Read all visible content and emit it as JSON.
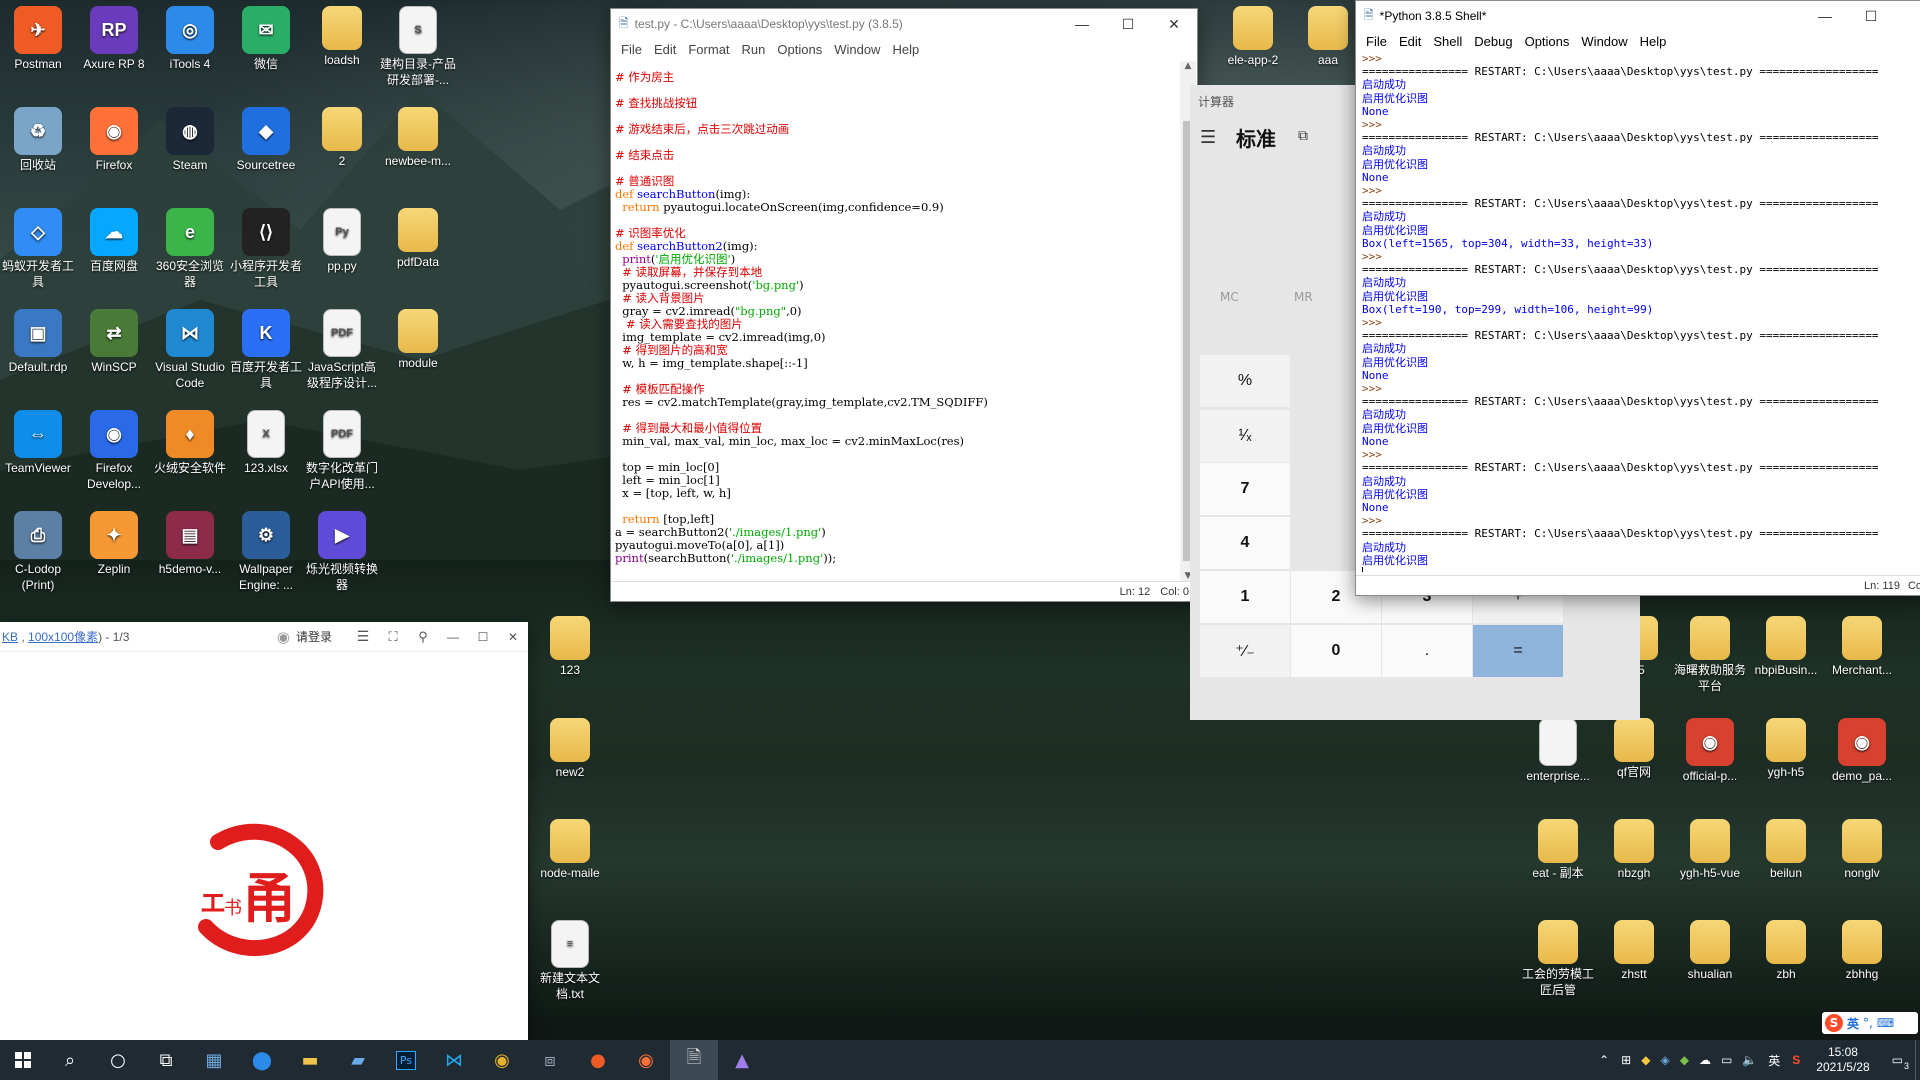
{
  "desktop": {
    "icons": [
      {
        "label": "Postman",
        "glyph": "✈",
        "color": "#ef5b25"
      },
      {
        "label": "Axure RP 8",
        "glyph": "RP",
        "color": "#6a3bbd"
      },
      {
        "label": "iTools 4",
        "glyph": "◎",
        "color": "#2c8ae8"
      },
      {
        "label": "微信",
        "glyph": "✉",
        "color": "#2aae67"
      },
      {
        "label": "loadsh",
        "glyph": "",
        "color": "folder"
      },
      {
        "label": "建构目录-产品研发部署-...",
        "glyph": "S",
        "color": "doc"
      },
      {
        "label": "回收站",
        "glyph": "♻",
        "color": "#7aa5c8"
      },
      {
        "label": "Firefox",
        "glyph": "◉",
        "color": "#ff7139"
      },
      {
        "label": "Steam",
        "glyph": "◍",
        "color": "#1b2838"
      },
      {
        "label": "Sourcetree",
        "glyph": "◆",
        "color": "#1f6fe0"
      },
      {
        "label": "2",
        "glyph": "",
        "color": "folder"
      },
      {
        "label": "newbee-m...",
        "glyph": "",
        "color": "folder"
      },
      {
        "label": "蚂蚁开发者工具",
        "glyph": "◇",
        "color": "#2f8df3"
      },
      {
        "label": "百度网盘",
        "glyph": "☁",
        "color": "#06a7ff"
      },
      {
        "label": "360安全浏览器",
        "glyph": "e",
        "color": "#3bb54a"
      },
      {
        "label": "小程序开发者工具",
        "glyph": "⟨⟩",
        "color": "#222"
      },
      {
        "label": "pp.py",
        "glyph": "Py",
        "color": "doc"
      },
      {
        "label": "pdfData",
        "glyph": "",
        "color": "folder"
      },
      {
        "label": "Default.rdp",
        "glyph": "▣",
        "color": "#3a78c3"
      },
      {
        "label": "WinSCP",
        "glyph": "⇄",
        "color": "#4a7a38"
      },
      {
        "label": "Visual Studio Code",
        "glyph": "⋈",
        "color": "#1f8ad2"
      },
      {
        "label": "百度开发者工具",
        "glyph": "K",
        "color": "#2a6ff5"
      },
      {
        "label": "JavaScript高级程序设计...",
        "glyph": "PDF",
        "color": "doc"
      },
      {
        "label": "module",
        "glyph": "",
        "color": "folder"
      },
      {
        "label": "TeamViewer",
        "glyph": "⇔",
        "color": "#0e8ee9"
      },
      {
        "label": "Firefox Develop...",
        "glyph": "◉",
        "color": "#2a6ae8"
      },
      {
        "label": "火绒安全软件",
        "glyph": "♦",
        "color": "#f08a24"
      },
      {
        "label": "123.xlsx",
        "glyph": "X",
        "color": "doc"
      },
      {
        "label": "数字化改革门户API使用...",
        "glyph": "PDF",
        "color": "doc"
      },
      {
        "label": "C-Lodop (Print)",
        "glyph": "⎙",
        "color": "#5c7fa6"
      },
      {
        "label": "Zeplin",
        "glyph": "✦",
        "color": "#f69833"
      },
      {
        "label": "h5demo-v...",
        "glyph": "▤",
        "color": "#8c2b4a"
      },
      {
        "label": "Wallpaper Engine: ...",
        "glyph": "⚙",
        "color": "#2a5d9a"
      },
      {
        "label": "烁光视频转换器",
        "glyph": "▶",
        "color": "#5f4bd8"
      },
      {
        "label": "ele-app-2",
        "glyph": "",
        "color": "folder"
      },
      {
        "label": "aaa",
        "glyph": "",
        "color": "folder"
      },
      {
        "label": "123",
        "glyph": "",
        "color": "folder"
      },
      {
        "label": "new2",
        "glyph": "",
        "color": "folder"
      },
      {
        "label": "node-maile",
        "glyph": "",
        "color": "folder"
      },
      {
        "label": "新建文本文档.txt",
        "glyph": "≡",
        "color": "doc"
      },
      {
        "label": "h5",
        "glyph": "",
        "color": "folder"
      },
      {
        "label": "海曙救助服务平台",
        "glyph": "",
        "color": "folder"
      },
      {
        "label": "nbpiBusin...",
        "glyph": "",
        "color": "folder"
      },
      {
        "label": "Merchant...",
        "glyph": "",
        "color": "folder"
      },
      {
        "label": "enterprise...",
        "glyph": "",
        "color": "doc"
      },
      {
        "label": "qf官网",
        "glyph": "",
        "color": "folder"
      },
      {
        "label": "official-p...",
        "glyph": "◉",
        "color": "#d8412f"
      },
      {
        "label": "ygh-h5",
        "glyph": "",
        "color": "folder"
      },
      {
        "label": "demo_pa...",
        "glyph": "◉",
        "color": "#d8412f"
      },
      {
        "label": "eat - 副本",
        "glyph": "",
        "color": "folder"
      },
      {
        "label": "nbzgh",
        "glyph": "",
        "color": "folder"
      },
      {
        "label": "ygh-h5-vue",
        "glyph": "",
        "color": "folder"
      },
      {
        "label": "beilun",
        "glyph": "",
        "color": "folder"
      },
      {
        "label": "nonglv",
        "glyph": "",
        "color": "folder"
      },
      {
        "label": "工会的劳模工匠后管",
        "glyph": "",
        "color": "folder"
      },
      {
        "label": "zhstt",
        "glyph": "",
        "color": "folder"
      },
      {
        "label": "shualian",
        "glyph": "",
        "color": "folder"
      },
      {
        "label": "zbh",
        "glyph": "",
        "color": "folder"
      },
      {
        "label": "zbhhg",
        "glyph": "",
        "color": "folder"
      }
    ]
  },
  "editor": {
    "title": "test.py - C:\\Users\\aaaa\\Desktop\\yys\\test.py (3.8.5)",
    "menu": [
      "File",
      "Edit",
      "Format",
      "Run",
      "Options",
      "Window",
      "Help"
    ],
    "status_ln": "Ln: 12",
    "status_col": "Col: 0",
    "lines": [
      [
        [
          "cm",
          "# 作为房主"
        ]
      ],
      [
        [
          "",
          ""
        ]
      ],
      [
        [
          "cm",
          "# 查找挑战按钮"
        ]
      ],
      [
        [
          "",
          ""
        ]
      ],
      [
        [
          "cm",
          "# 游戏结束后，点击三次跳过动画"
        ]
      ],
      [
        [
          "",
          ""
        ]
      ],
      [
        [
          "cm",
          "# 结束点击"
        ]
      ],
      [
        [
          "",
          ""
        ]
      ],
      [
        [
          "cm",
          "# 普通识图"
        ]
      ],
      [
        [
          "kw",
          "def "
        ],
        [
          "df",
          "searchButton"
        ],
        [
          "",
          "(img):"
        ]
      ],
      [
        [
          "kw",
          "  return "
        ],
        [
          "",
          "pyautogui.locateOnScreen(img,confidence=0.9)"
        ]
      ],
      [
        [
          "",
          ""
        ]
      ],
      [
        [
          "cm",
          "# 识图率优化"
        ]
      ],
      [
        [
          "kw",
          "def "
        ],
        [
          "df",
          "searchButton2"
        ],
        [
          "",
          "(img):"
        ]
      ],
      [
        [
          "bi",
          "  print"
        ],
        [
          "",
          "("
        ],
        [
          "st",
          "'启用优化识图'"
        ],
        [
          "",
          ")"
        ]
      ],
      [
        [
          "cm",
          "  # 读取屏幕，并保存到本地"
        ]
      ],
      [
        [
          "",
          "  pyautogui.screenshot("
        ],
        [
          "st",
          "'bg.png'"
        ],
        [
          "",
          ")"
        ]
      ],
      [
        [
          "cm",
          "  # 读入背景图片"
        ]
      ],
      [
        [
          "",
          "  gray = cv2.imread("
        ],
        [
          "st",
          "\"bg.png\""
        ],
        [
          "",
          ",0)"
        ]
      ],
      [
        [
          "cm",
          "   # 读入需要查找的图片"
        ]
      ],
      [
        [
          "",
          "  img_template = cv2.imread(img,0)"
        ]
      ],
      [
        [
          "cm",
          "  # 得到图片的高和宽"
        ]
      ],
      [
        [
          "",
          "  w, h = img_template.shape[::-1]"
        ]
      ],
      [
        [
          "",
          ""
        ]
      ],
      [
        [
          "cm",
          "  # 模板匹配操作"
        ]
      ],
      [
        [
          "",
          "  res = cv2.matchTemplate(gray,img_template,cv2.TM_SQDIFF)"
        ]
      ],
      [
        [
          "",
          ""
        ]
      ],
      [
        [
          "cm",
          "  # 得到最大和最小值得位置"
        ]
      ],
      [
        [
          "",
          "  min_val, max_val, min_loc, max_loc = cv2.minMaxLoc(res)"
        ]
      ],
      [
        [
          "",
          ""
        ]
      ],
      [
        [
          "",
          "  top = min_loc[0]"
        ]
      ],
      [
        [
          "",
          "  left = min_loc[1]"
        ]
      ],
      [
        [
          "",
          "  x = [top, left, w, h]"
        ]
      ],
      [
        [
          "",
          ""
        ]
      ],
      [
        [
          "kw",
          "  return "
        ],
        [
          "",
          "[top,left]"
        ]
      ],
      [
        [
          "",
          "a = searchButton2("
        ],
        [
          "st",
          "'./images/1.png'"
        ],
        [
          "",
          ")"
        ]
      ],
      [
        [
          "",
          "pyautogui.moveTo(a[0], a[1])"
        ]
      ],
      [
        [
          "bi",
          "print"
        ],
        [
          "",
          "(searchButton("
        ],
        [
          "st",
          "'./images/1.png'"
        ],
        [
          "",
          "));"
        ]
      ]
    ]
  },
  "shell": {
    "title": "*Python 3.8.5 Shell*",
    "menu": [
      "File",
      "Edit",
      "Shell",
      "Debug",
      "Options",
      "Window",
      "Help"
    ],
    "status_ln": "Ln: 119",
    "status_col": "Co",
    "lines": [
      [
        [
          "prompt",
          ">>> "
        ]
      ],
      [
        [
          "",
          "================ RESTART: C:\\Users\\aaaa\\Desktop\\yys\\test.py =================="
        ]
      ],
      [
        [
          "out",
          "启动成功"
        ]
      ],
      [
        [
          "out",
          "启用优化识图"
        ]
      ],
      [
        [
          "out",
          "None"
        ]
      ],
      [
        [
          "prompt",
          ">>> "
        ]
      ],
      [
        [
          "",
          "================ RESTART: C:\\Users\\aaaa\\Desktop\\yys\\test.py =================="
        ]
      ],
      [
        [
          "out",
          "启动成功"
        ]
      ],
      [
        [
          "out",
          "启用优化识图"
        ]
      ],
      [
        [
          "out",
          "None"
        ]
      ],
      [
        [
          "prompt",
          ">>> "
        ]
      ],
      [
        [
          "",
          "================ RESTART: C:\\Users\\aaaa\\Desktop\\yys\\test.py =================="
        ]
      ],
      [
        [
          "out",
          "启动成功"
        ]
      ],
      [
        [
          "out",
          "启用优化识图"
        ]
      ],
      [
        [
          "out",
          "Box(left=1565, top=304, width=33, height=33)"
        ]
      ],
      [
        [
          "prompt",
          ">>> "
        ]
      ],
      [
        [
          "",
          "================ RESTART: C:\\Users\\aaaa\\Desktop\\yys\\test.py =================="
        ]
      ],
      [
        [
          "out",
          "启动成功"
        ]
      ],
      [
        [
          "out",
          "启用优化识图"
        ]
      ],
      [
        [
          "out",
          "Box(left=190, top=299, width=106, height=99)"
        ]
      ],
      [
        [
          "prompt",
          ">>> "
        ]
      ],
      [
        [
          "",
          "================ RESTART: C:\\Users\\aaaa\\Desktop\\yys\\test.py =================="
        ]
      ],
      [
        [
          "out",
          "启动成功"
        ]
      ],
      [
        [
          "out",
          "启用优化识图"
        ]
      ],
      [
        [
          "out",
          "None"
        ]
      ],
      [
        [
          "prompt",
          ">>> "
        ]
      ],
      [
        [
          "",
          "================ RESTART: C:\\Users\\aaaa\\Desktop\\yys\\test.py =================="
        ]
      ],
      [
        [
          "out",
          "启动成功"
        ]
      ],
      [
        [
          "out",
          "启用优化识图"
        ]
      ],
      [
        [
          "out",
          "None"
        ]
      ],
      [
        [
          "prompt",
          ">>> "
        ]
      ],
      [
        [
          "",
          "================ RESTART: C:\\Users\\aaaa\\Desktop\\yys\\test.py =================="
        ]
      ],
      [
        [
          "out",
          "启动成功"
        ]
      ],
      [
        [
          "out",
          "启用优化识图"
        ]
      ],
      [
        [
          "out",
          "None"
        ]
      ],
      [
        [
          "prompt",
          ">>> "
        ]
      ],
      [
        [
          "",
          "================ RESTART: C:\\Users\\aaaa\\Desktop\\yys\\test.py =================="
        ]
      ],
      [
        [
          "out",
          "启动成功"
        ]
      ],
      [
        [
          "out",
          "启用优化识图"
        ]
      ]
    ]
  },
  "calculator": {
    "title": "计算器",
    "mode": "标准",
    "memory": [
      "MC",
      "MR"
    ],
    "buttons": [
      "%",
      "¹⁄ₓ",
      "7",
      "4",
      "1",
      "2",
      "3",
      "+",
      "⁺⁄₋",
      "0",
      ".",
      "="
    ],
    "accent": "#8fb4dc"
  },
  "viewer": {
    "info": "KB , 100x100像素) - 1/3",
    "info_link": "100x100像素",
    "login": "请登录",
    "stamp_char": "甬",
    "stamp_small": "书"
  },
  "taskbar": {
    "clock_time": "15:08",
    "clock_date": "2021/5/28",
    "ime": "英",
    "notify_count": "3",
    "tray_lang": "英"
  }
}
